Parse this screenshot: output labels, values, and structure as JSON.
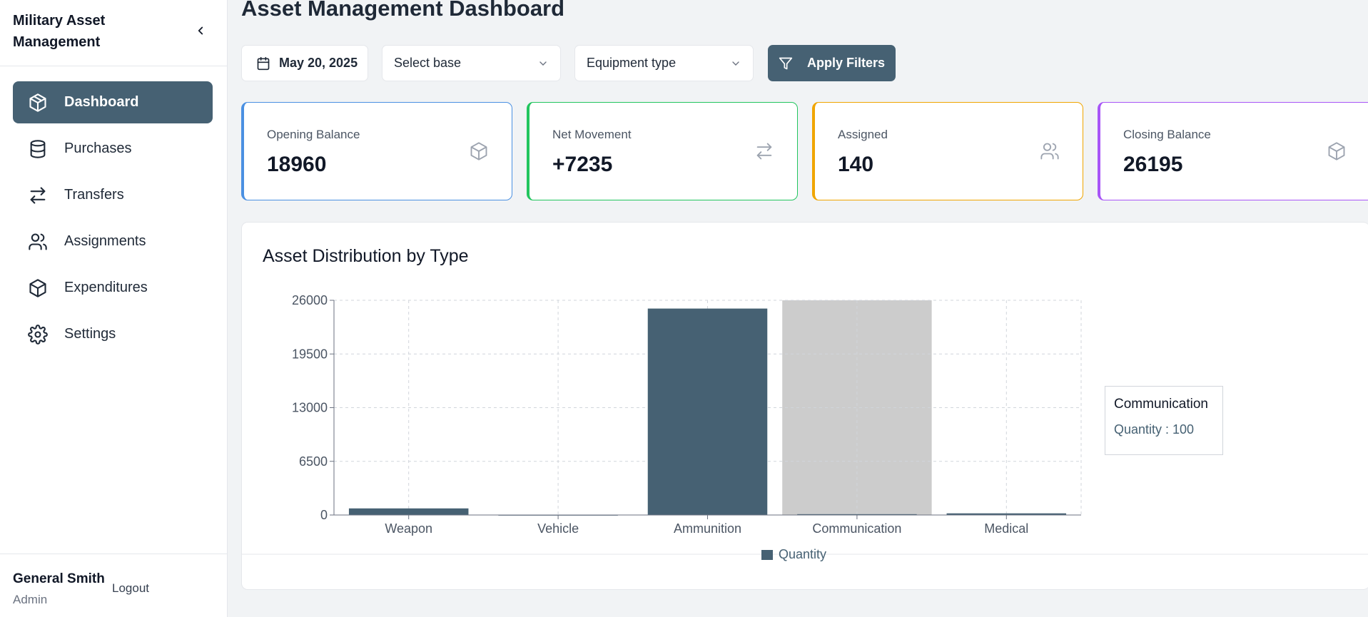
{
  "sidebar": {
    "title": "Military Asset Management",
    "items": [
      {
        "label": "Dashboard",
        "icon": "box-icon",
        "active": true
      },
      {
        "label": "Purchases",
        "icon": "database-icon",
        "active": false
      },
      {
        "label": "Transfers",
        "icon": "arrows-swap-icon",
        "active": false
      },
      {
        "label": "Assignments",
        "icon": "users-icon",
        "active": false
      },
      {
        "label": "Expenditures",
        "icon": "box-icon",
        "active": false
      },
      {
        "label": "Settings",
        "icon": "gear-icon",
        "active": false
      }
    ],
    "user": {
      "name": "General Smith",
      "role": "Admin"
    },
    "logout_label": "Logout"
  },
  "header": {
    "title": "Asset Management Dashboard"
  },
  "filters": {
    "date": "May 20, 2025",
    "base_placeholder": "Select base",
    "equipment_placeholder": "Equipment type",
    "apply_label": "Apply Filters"
  },
  "cards": [
    {
      "label": "Opening Balance",
      "value": "18960",
      "icon": "box-icon",
      "color": "#4a90e2"
    },
    {
      "label": "Net Movement",
      "value": "+7235",
      "icon": "arrows-swap-icon",
      "color": "#22c55e"
    },
    {
      "label": "Assigned",
      "value": "140",
      "icon": "users-icon",
      "color": "#f0a500"
    },
    {
      "label": "Closing Balance",
      "value": "26195",
      "icon": "box-icon",
      "color": "#a855f7"
    }
  ],
  "chart_data": {
    "type": "bar",
    "title": "Asset Distribution by Type",
    "categories": [
      "Weapon",
      "Vehicle",
      "Ammunition",
      "Communication",
      "Medical"
    ],
    "series": [
      {
        "name": "Quantity",
        "values": [
          800,
          15,
          25000,
          100,
          200
        ],
        "color": "#466173"
      }
    ],
    "yticks": [
      "0",
      "6500",
      "13000",
      "19500",
      "26000"
    ],
    "ylim": [
      0,
      26000
    ],
    "grid": true,
    "legend": "bottom",
    "highlighted_category": "Communication",
    "tooltip": {
      "title": "Communication",
      "text": "Quantity : 100"
    }
  },
  "colors": {
    "accent": "#466173",
    "highlight": "#cccccc"
  }
}
